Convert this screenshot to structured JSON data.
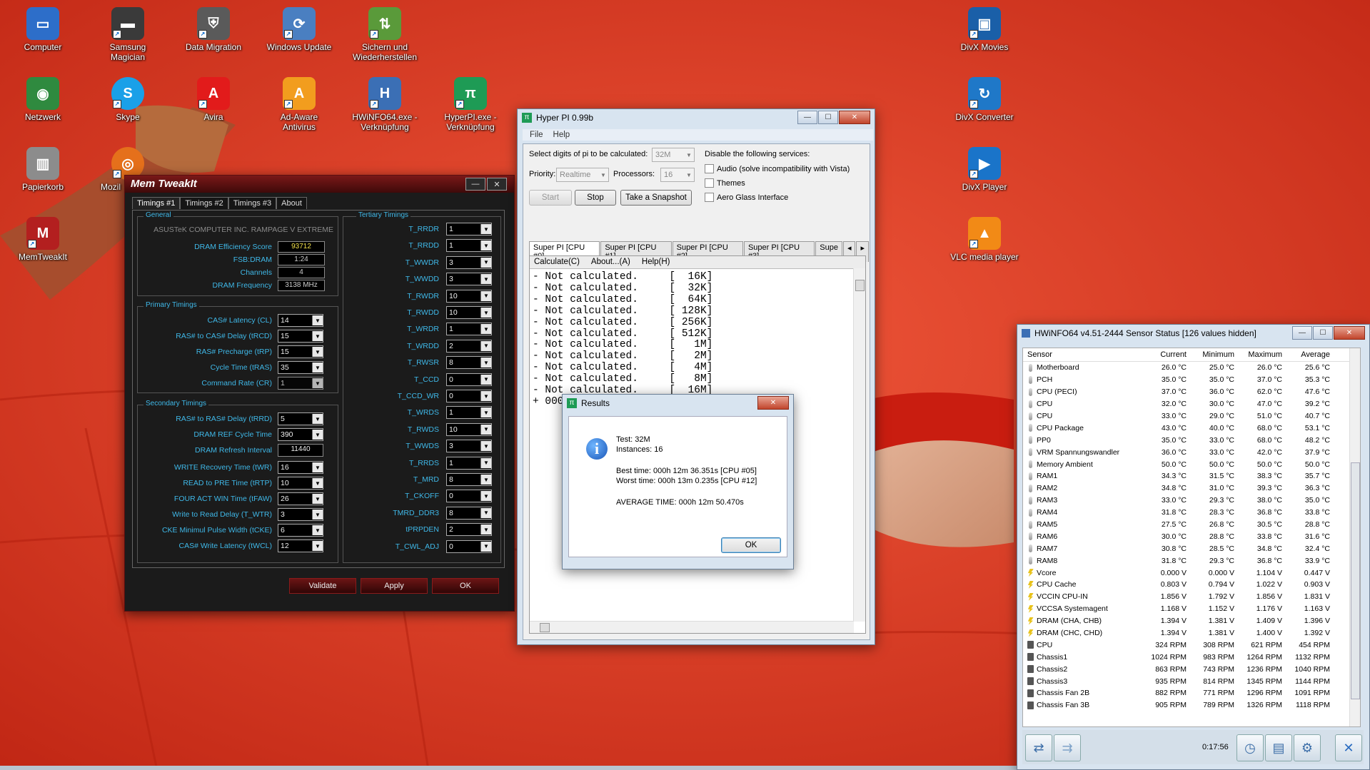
{
  "desktop": {
    "icons": [
      {
        "label": "Computer",
        "icon": "computer-icon",
        "color": "#2d6ec9",
        "glyph": "▭"
      },
      {
        "label": "Samsung Magician",
        "icon": "samsung-magician-icon",
        "color": "#3a3a3a",
        "glyph": "▬"
      },
      {
        "label": "Data Migration",
        "icon": "data-migration-icon",
        "color": "#5a5a5a",
        "glyph": "⛨"
      },
      {
        "label": "Windows Update",
        "icon": "windows-update-icon",
        "color": "#4a7fc1",
        "glyph": "⟳"
      },
      {
        "label": "Sichern und Wiederherstellen",
        "icon": "backup-restore-icon",
        "color": "#5a9a3a",
        "glyph": "⇅"
      },
      {
        "label": "DivX Movies",
        "icon": "divx-movies-icon",
        "color": "#1a5fa8",
        "glyph": "▣"
      },
      {
        "label": "Netzwerk",
        "icon": "network-icon",
        "color": "#2f8a3f",
        "glyph": "◉"
      },
      {
        "label": "Skype",
        "icon": "skype-icon",
        "color": "#1aa0e8",
        "glyph": "S"
      },
      {
        "label": "Avira",
        "icon": "avira-icon",
        "color": "#e21b1b",
        "glyph": "A"
      },
      {
        "label": "Ad-Aware Antivirus",
        "icon": "ad-aware-icon",
        "color": "#f29d1e",
        "glyph": "A"
      },
      {
        "label": "HWiNFO64.exe - Verknüpfung",
        "icon": "hwinfo-icon",
        "color": "#3b6fb5",
        "glyph": "H"
      },
      {
        "label": "HyperPI.exe - Verknüpfung",
        "icon": "hyperpi-icon",
        "color": "#1e9b55",
        "glyph": "π"
      },
      {
        "label": "DivX Converter",
        "icon": "divx-converter-icon",
        "color": "#1f78c8",
        "glyph": "↻"
      },
      {
        "label": "Papierkorb",
        "icon": "recycle-bin-icon",
        "color": "#8c8c8c",
        "glyph": "🗑"
      },
      {
        "label": "Mozil",
        "icon": "firefox-icon",
        "color": "#e5701b",
        "glyph": "◎"
      },
      {
        "label": "DivX Player",
        "icon": "divx-player-icon",
        "color": "#1a74c9",
        "glyph": "▶"
      },
      {
        "label": "MemTweakIt",
        "icon": "memtweakit-icon",
        "color": "#b31f1f",
        "glyph": "M"
      },
      {
        "label": "VLC media player",
        "icon": "vlc-icon",
        "color": "#f28a16",
        "glyph": "▲"
      }
    ]
  },
  "memtweak": {
    "title": "Mem TweakIt",
    "tabs": [
      "Timings #1",
      "Timings #2",
      "Timings #3",
      "About"
    ],
    "general": {
      "label": "General",
      "board": "ASUSTeK COMPUTER INC. RAMPAGE V EXTREME",
      "rows": [
        {
          "label": "DRAM Efficiency Score",
          "value": "93712"
        },
        {
          "label": "FSB:DRAM",
          "value": "1:24"
        },
        {
          "label": "Channels",
          "value": "4"
        },
        {
          "label": "DRAM Frequency",
          "value": "3138 MHz"
        }
      ]
    },
    "primary": {
      "label": "Primary Timings",
      "rows": [
        {
          "label": "CAS# Latency (CL)",
          "value": "14"
        },
        {
          "label": "RAS# to CAS# Delay (tRCD)",
          "value": "15"
        },
        {
          "label": "RAS# Precharge (tRP)",
          "value": "15"
        },
        {
          "label": "Cycle Time (tRAS)",
          "value": "35"
        },
        {
          "label": "Command Rate (CR)",
          "value": "1"
        }
      ]
    },
    "secondary": {
      "label": "Secondary Timings",
      "rows": [
        {
          "label": "RAS# to RAS# Delay (tRRD)",
          "value": "5"
        },
        {
          "label": "DRAM REF Cycle Time",
          "value": "390"
        },
        {
          "label": "DRAM Refresh Interval",
          "value": "11440"
        },
        {
          "label": "WRITE Recovery Time (tWR)",
          "value": "16"
        },
        {
          "label": "READ to PRE Time (tRTP)",
          "value": "10"
        },
        {
          "label": "FOUR ACT WIN Time (tFAW)",
          "value": "26"
        },
        {
          "label": "Write to Read Delay (T_WTR)",
          "value": "3"
        },
        {
          "label": "CKE Minimul Pulse Width (tCKE)",
          "value": "6"
        },
        {
          "label": "CAS# Write Latency (tWCL)",
          "value": "12"
        }
      ]
    },
    "tertiary": {
      "label": "Tertiary Timings",
      "rows": [
        {
          "label": "T_RRDR",
          "value": "1"
        },
        {
          "label": "T_RRDD",
          "value": "1"
        },
        {
          "label": "T_WWDR",
          "value": "3"
        },
        {
          "label": "T_WWDD",
          "value": "3"
        },
        {
          "label": "T_RWDR",
          "value": "10"
        },
        {
          "label": "T_RWDD",
          "value": "10"
        },
        {
          "label": "T_WRDR",
          "value": "1"
        },
        {
          "label": "T_WRDD",
          "value": "2"
        },
        {
          "label": "T_RWSR",
          "value": "8"
        },
        {
          "label": "T_CCD",
          "value": "0"
        },
        {
          "label": "T_CCD_WR",
          "value": "0"
        },
        {
          "label": "T_WRDS",
          "value": "1"
        },
        {
          "label": "T_RWDS",
          "value": "10"
        },
        {
          "label": "T_WWDS",
          "value": "3"
        },
        {
          "label": "T_RRDS",
          "value": "1"
        },
        {
          "label": "T_MRD",
          "value": "8"
        },
        {
          "label": "T_CKOFF",
          "value": "0"
        },
        {
          "label": "TMRD_DDR3",
          "value": "8"
        },
        {
          "label": "tPRPDEN",
          "value": "2"
        },
        {
          "label": "T_CWL_ADJ",
          "value": "0"
        }
      ]
    },
    "buttons": {
      "validate": "Validate",
      "apply": "Apply",
      "ok": "OK"
    }
  },
  "hyperpi": {
    "title": "Hyper PI 0.99b",
    "menu": [
      "File",
      "Help"
    ],
    "digits_label": "Select digits of pi to be calculated:",
    "digits_value": "32M",
    "priority_label": "Priority:",
    "priority_value": "Realtime",
    "processors_label": "Processors:",
    "processors_value": "16",
    "services_label": "Disable the following services:",
    "services": [
      "Audio (solve incompatibility with Vista)",
      "Themes",
      "Aero Glass Interface"
    ],
    "buttons": {
      "start": "Start",
      "stop": "Stop",
      "snapshot": "Take a Snapshot"
    },
    "cpu_tabs": [
      "Super PI [CPU #0]",
      "Super PI [CPU #1]",
      "Super PI [CPU #2]",
      "Super PI [CPU #3]",
      "Supe"
    ],
    "superpi_menu": [
      "Calculate(C)",
      "About...(A)",
      "Help(H)"
    ],
    "output_lines": [
      "- Not calculated.     [  16K]",
      "- Not calculated.     [  32K]",
      "- Not calculated.     [  64K]",
      "- Not calculated.     [ 128K]",
      "- Not calculated.     [ 256K]",
      "- Not calculated.     [ 512K]",
      "- Not calculated.     [   1M]",
      "- Not calculated.     [   2M]",
      "- Not calculated.     [   4M]",
      "- Not calculated.     [   8M]",
      "- Not calculated.     [  16M]",
      "+ 000h 12m 47.786s    [  32M]"
    ]
  },
  "results": {
    "title": "Results",
    "test": "Test: 32M",
    "instances": "Instances: 16",
    "best": "Best time: 000h 12m 36.351s [CPU #05]",
    "worst": "Worst time: 000h 13m 0.235s [CPU #12]",
    "average": "AVERAGE TIME: 000h 12m 50.470s",
    "ok": "OK"
  },
  "hwinfo": {
    "title": "HWiNFO64 v4.51-2444 Sensor Status [126 values hidden]",
    "columns": [
      "Sensor",
      "Current",
      "Minimum",
      "Maximum",
      "Average"
    ],
    "rows": [
      {
        "kind": "temp",
        "cells": [
          "Motherboard",
          "26.0 °C",
          "25.0 °C",
          "26.0 °C",
          "25.6 °C"
        ]
      },
      {
        "kind": "temp",
        "cells": [
          "PCH",
          "35.0 °C",
          "35.0 °C",
          "37.0 °C",
          "35.3 °C"
        ]
      },
      {
        "kind": "temp",
        "cells": [
          "CPU (PECI)",
          "37.0 °C",
          "36.0 °C",
          "62.0 °C",
          "47.6 °C"
        ]
      },
      {
        "kind": "temp",
        "cells": [
          "CPU",
          "32.0 °C",
          "30.0 °C",
          "47.0 °C",
          "39.2 °C"
        ]
      },
      {
        "kind": "temp",
        "cells": [
          "CPU",
          "33.0 °C",
          "29.0 °C",
          "51.0 °C",
          "40.7 °C"
        ]
      },
      {
        "kind": "temp",
        "cells": [
          "CPU Package",
          "43.0 °C",
          "40.0 °C",
          "68.0 °C",
          "53.1 °C"
        ]
      },
      {
        "kind": "temp",
        "cells": [
          "PP0",
          "35.0 °C",
          "33.0 °C",
          "68.0 °C",
          "48.2 °C"
        ]
      },
      {
        "kind": "temp",
        "cells": [
          "VRM Spannungswandler",
          "36.0 °C",
          "33.0 °C",
          "42.0 °C",
          "37.9 °C"
        ]
      },
      {
        "kind": "temp",
        "cells": [
          "Memory Ambient",
          "50.0 °C",
          "50.0 °C",
          "50.0 °C",
          "50.0 °C"
        ]
      },
      {
        "kind": "temp",
        "cells": [
          "RAM1",
          "34.3 °C",
          "31.5 °C",
          "38.3 °C",
          "35.7 °C"
        ]
      },
      {
        "kind": "temp",
        "cells": [
          "RAM2",
          "34.8 °C",
          "31.0 °C",
          "39.3 °C",
          "36.3 °C"
        ]
      },
      {
        "kind": "temp",
        "cells": [
          "RAM3",
          "33.0 °C",
          "29.3 °C",
          "38.0 °C",
          "35.0 °C"
        ]
      },
      {
        "kind": "temp",
        "cells": [
          "RAM4",
          "31.8 °C",
          "28.3 °C",
          "36.8 °C",
          "33.8 °C"
        ]
      },
      {
        "kind": "temp",
        "cells": [
          "RAM5",
          "27.5 °C",
          "26.8 °C",
          "30.5 °C",
          "28.8 °C"
        ]
      },
      {
        "kind": "temp",
        "cells": [
          "RAM6",
          "30.0 °C",
          "28.8 °C",
          "33.8 °C",
          "31.6 °C"
        ]
      },
      {
        "kind": "temp",
        "cells": [
          "RAM7",
          "30.8 °C",
          "28.5 °C",
          "34.8 °C",
          "32.4 °C"
        ]
      },
      {
        "kind": "temp",
        "cells": [
          "RAM8",
          "31.8 °C",
          "29.3 °C",
          "36.8 °C",
          "33.9 °C"
        ]
      },
      {
        "kind": "volt",
        "cells": [
          "Vcore",
          "0.000 V",
          "0.000 V",
          "1.104 V",
          "0.447 V"
        ]
      },
      {
        "kind": "volt",
        "cells": [
          "CPU Cache",
          "0.803 V",
          "0.794 V",
          "1.022 V",
          "0.903 V"
        ]
      },
      {
        "kind": "volt",
        "cells": [
          "VCCIN CPU-IN",
          "1.856 V",
          "1.792 V",
          "1.856 V",
          "1.831 V"
        ]
      },
      {
        "kind": "volt",
        "cells": [
          "VCCSA Systemagent",
          "1.168 V",
          "1.152 V",
          "1.176 V",
          "1.163 V"
        ]
      },
      {
        "kind": "volt",
        "cells": [
          "DRAM (CHA, CHB)",
          "1.394 V",
          "1.381 V",
          "1.409 V",
          "1.396 V"
        ]
      },
      {
        "kind": "volt",
        "cells": [
          "DRAM (CHC, CHD)",
          "1.394 V",
          "1.381 V",
          "1.400 V",
          "1.392 V"
        ]
      },
      {
        "kind": "fan",
        "cells": [
          "CPU",
          "324 RPM",
          "308 RPM",
          "621 RPM",
          "454 RPM"
        ]
      },
      {
        "kind": "fan",
        "cells": [
          "Chassis1",
          "1024 RPM",
          "983 RPM",
          "1264 RPM",
          "1132 RPM"
        ]
      },
      {
        "kind": "fan",
        "cells": [
          "Chassis2",
          "863 RPM",
          "743 RPM",
          "1236 RPM",
          "1040 RPM"
        ]
      },
      {
        "kind": "fan",
        "cells": [
          "Chassis3",
          "935 RPM",
          "814 RPM",
          "1345 RPM",
          "1144 RPM"
        ]
      },
      {
        "kind": "fan",
        "cells": [
          "Chassis Fan 2B",
          "882 RPM",
          "771 RPM",
          "1296 RPM",
          "1091 RPM"
        ]
      },
      {
        "kind": "fan",
        "cells": [
          "Chassis Fan 3B",
          "905 RPM",
          "789 RPM",
          "1326 RPM",
          "1118 RPM"
        ]
      }
    ],
    "elapsed": "0:17:56"
  }
}
